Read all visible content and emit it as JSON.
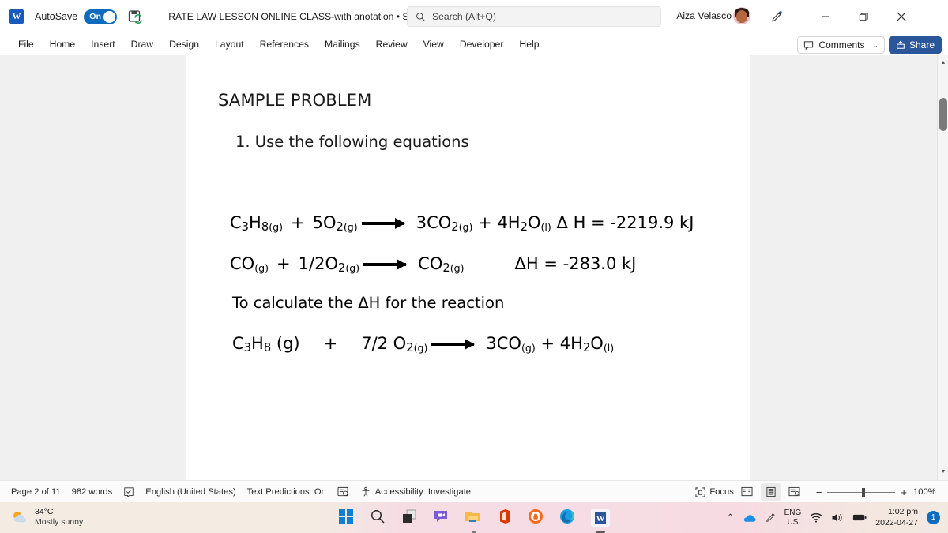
{
  "titlebar": {
    "app_icon": "word-logo-icon",
    "autosave_label": "AutoSave",
    "autosave_state": "On",
    "save_sync_icon": "save-sync-icon",
    "document_title": "RATE LAW LESSON ONLINE CLASS-with anotation • Saving...",
    "title_caret": "▾",
    "search_placeholder": "Search (Alt+Q)",
    "search_value": "",
    "user_name": "Aiza Velasco",
    "pen_icon": "pen-edit-icon",
    "minimize_icon": "minimize-icon",
    "restore_icon": "restore-icon",
    "close_icon": "close-icon"
  },
  "ribbon": {
    "tabs": [
      {
        "label": "File"
      },
      {
        "label": "Home"
      },
      {
        "label": "Insert"
      },
      {
        "label": "Draw"
      },
      {
        "label": "Design"
      },
      {
        "label": "Layout"
      },
      {
        "label": "References"
      },
      {
        "label": "Mailings"
      },
      {
        "label": "Review"
      },
      {
        "label": "View"
      },
      {
        "label": "Developer"
      },
      {
        "label": "Help"
      }
    ],
    "comments_label": "Comments",
    "comments_caret": "⌄",
    "share_label": "Share",
    "share_color": "#2b579a"
  },
  "document": {
    "heading": "SAMPLE PROBLEM",
    "list_item_1": "1. Use the following equations",
    "equation_1": {
      "reactant_1_formula": "C",
      "reactant_1_sub1": "3",
      "reactant_1_h": "H",
      "reactant_1_sub2": "8",
      "reactant_1_state": "(g)",
      "plus": "+",
      "reactant_2": "5O",
      "reactant_2_sub": "2",
      "reactant_2_state": "(g)",
      "product_1": "3CO",
      "product_1_sub": "2",
      "product_1_state": "(g)",
      "product_2": "4H",
      "product_2_sub": "2",
      "product_2_o": "O",
      "product_2_state": "(l)",
      "delta": "Δ",
      "enthalpy_label": "H =",
      "enthalpy_value": "-2219.9 kJ"
    },
    "equation_2": {
      "reactant_1": "CO",
      "reactant_1_state": "(g)",
      "plus": "+",
      "reactant_2": "1/2O",
      "reactant_2_sub": "2",
      "reactant_2_state": "(g)",
      "product_1": "CO",
      "product_1_sub": "2",
      "product_1_state": "(g)",
      "enthalpy": "ΔH = -283.0 kJ"
    },
    "line_3": "To calculate the  ΔH for the reaction",
    "equation_3": {
      "reactant_1": "C",
      "reactant_1_sub1": "3",
      "reactant_1_h": "H",
      "reactant_1_sub2": "8",
      "reactant_1_state": "(g)",
      "plus_1": "+",
      "reactant_2": "7/2 O",
      "reactant_2_sub": "2",
      "reactant_2_state": "(g)",
      "product_1": "3CO",
      "product_1_state": "(g)",
      "plus_2": "+",
      "product_2": "4H",
      "product_2_sub": "2",
      "product_2_o": "O",
      "product_2_state": "(l)"
    }
  },
  "statusbar": {
    "page_info": "Page 2 of 11",
    "word_count": "982 words",
    "proofing_icon": "proofing-check-icon",
    "language": "English (United States)",
    "text_predictions": "Text Predictions: On",
    "editor_icon": "editor-score-icon",
    "accessibility": "Accessibility: Investigate",
    "focus_label": "Focus",
    "view_read_icon": "read-mode-icon",
    "view_print_icon": "print-layout-icon",
    "view_web_icon": "web-layout-icon",
    "zoom_out": "−",
    "zoom_in": "+",
    "zoom_level": "100%"
  },
  "taskbar": {
    "weather_temp": "34°C",
    "weather_desc": "Mostly sunny",
    "weather_icon": "sun-behind-cloud-icon",
    "icons": [
      {
        "name": "start-icon"
      },
      {
        "name": "search-icon"
      },
      {
        "name": "task-view-icon"
      },
      {
        "name": "chat-teams-icon"
      },
      {
        "name": "file-explorer-icon"
      },
      {
        "name": "office-icon"
      },
      {
        "name": "secure-browser-icon"
      },
      {
        "name": "edge-icon"
      },
      {
        "name": "word-taskbar-icon"
      }
    ],
    "tray": {
      "overflow_icon": "show-hidden-icons-chevron",
      "onedrive_icon": "onedrive-cloud-icon",
      "pen_icon": "tray-pen-icon",
      "lang_line1": "ENG",
      "lang_line2": "US",
      "wifi_icon": "wifi-icon",
      "volume_icon": "volume-icon",
      "battery_icon": "battery-icon",
      "time": "1:02 pm",
      "date": "2022-04-27",
      "notification_count": "1"
    }
  }
}
